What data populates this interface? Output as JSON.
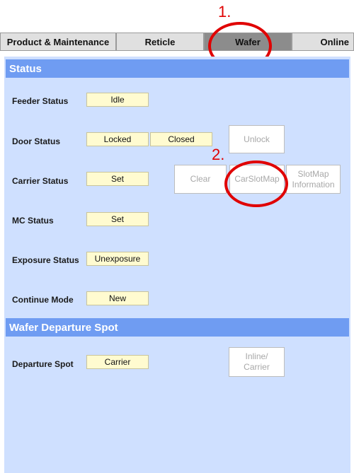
{
  "tabs": [
    {
      "label": "Product & Maintenance",
      "active": false
    },
    {
      "label": "Reticle",
      "active": false
    },
    {
      "label": "Wafer",
      "active": true
    },
    {
      "label": "Online",
      "active": false
    }
  ],
  "sections": {
    "status": {
      "title": "Status"
    },
    "departure": {
      "title": "Wafer Departure Spot"
    }
  },
  "status_rows": {
    "feeder": {
      "label": "Feeder Status",
      "value": "Idle"
    },
    "door": {
      "label": "Door Status",
      "value1": "Locked",
      "value2": "Closed"
    },
    "carrier": {
      "label": "Carrier Status",
      "value": "Set"
    },
    "mc": {
      "label": "MC Status",
      "value": "Set"
    },
    "exposure": {
      "label": "Exposure Status",
      "value": "Unexposure"
    },
    "continue": {
      "label": "Continue Mode",
      "value": "New"
    }
  },
  "departure_row": {
    "label": "Departure Spot",
    "value": "Carrier"
  },
  "buttons": {
    "unlock": "Unlock",
    "clear": "Clear",
    "carslotmap": "CarSlotMap",
    "slotmap_info_line1": "SlotMap",
    "slotmap_info_line2": "Information",
    "inline_carrier_line1": "Inline/",
    "inline_carrier_line2": "Carrier"
  },
  "annotations": {
    "step1": "1.",
    "step2": "2.",
    "color": "#e00000"
  },
  "colors": {
    "panel_bg": "#cfe0ff",
    "section_header": "#6f9cf2",
    "field_bg": "#fffbd0",
    "active_tab": "#8c8c8c"
  }
}
